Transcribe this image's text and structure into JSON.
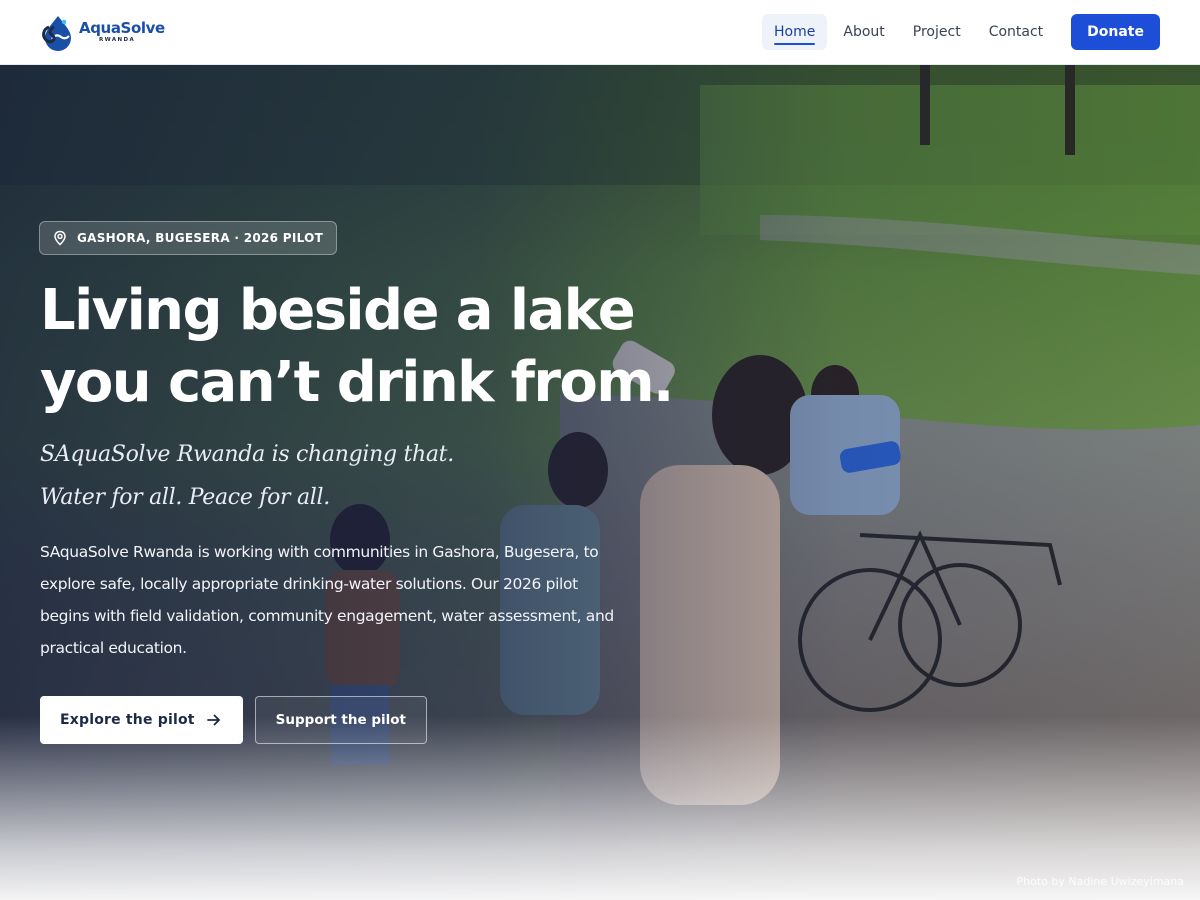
{
  "colors": {
    "brand_blue": "#1d4ed8",
    "navy": "#1c2a48",
    "white": "#ffffff"
  },
  "header": {
    "logo": {
      "mark_icon": "water-drop-logo-icon",
      "wordmark": "AquaSolve",
      "subtitle": "RWANDA"
    },
    "nav": {
      "items": [
        {
          "label": "Home",
          "active": true
        },
        {
          "label": "About",
          "active": false
        },
        {
          "label": "Project",
          "active": false
        },
        {
          "label": "Contact",
          "active": false
        }
      ],
      "donate_label": "Donate"
    }
  },
  "hero": {
    "badge": {
      "icon": "map-pin-icon",
      "text": "GASHORA, BUGESERA · 2026 PILOT"
    },
    "title_lines": [
      "Living beside a lake",
      "you can’t drink from."
    ],
    "tagline_lines": [
      "SAquaSolve Rwanda is changing that.",
      "Water for all. Peace for all."
    ],
    "description": "SAquaSolve Rwanda is working with communities in Gashora, Bugesera, to explore safe, locally appropriate drinking-water solutions. Our 2026 pilot begins with field validation, community engagement, water assessment, and practical education.",
    "cta_primary": {
      "label": "Explore the pilot",
      "icon": "arrow-right-icon"
    },
    "cta_secondary": {
      "label": "Support the pilot"
    },
    "photo_credit": "Photo by Nadine Uwizeyimana"
  }
}
